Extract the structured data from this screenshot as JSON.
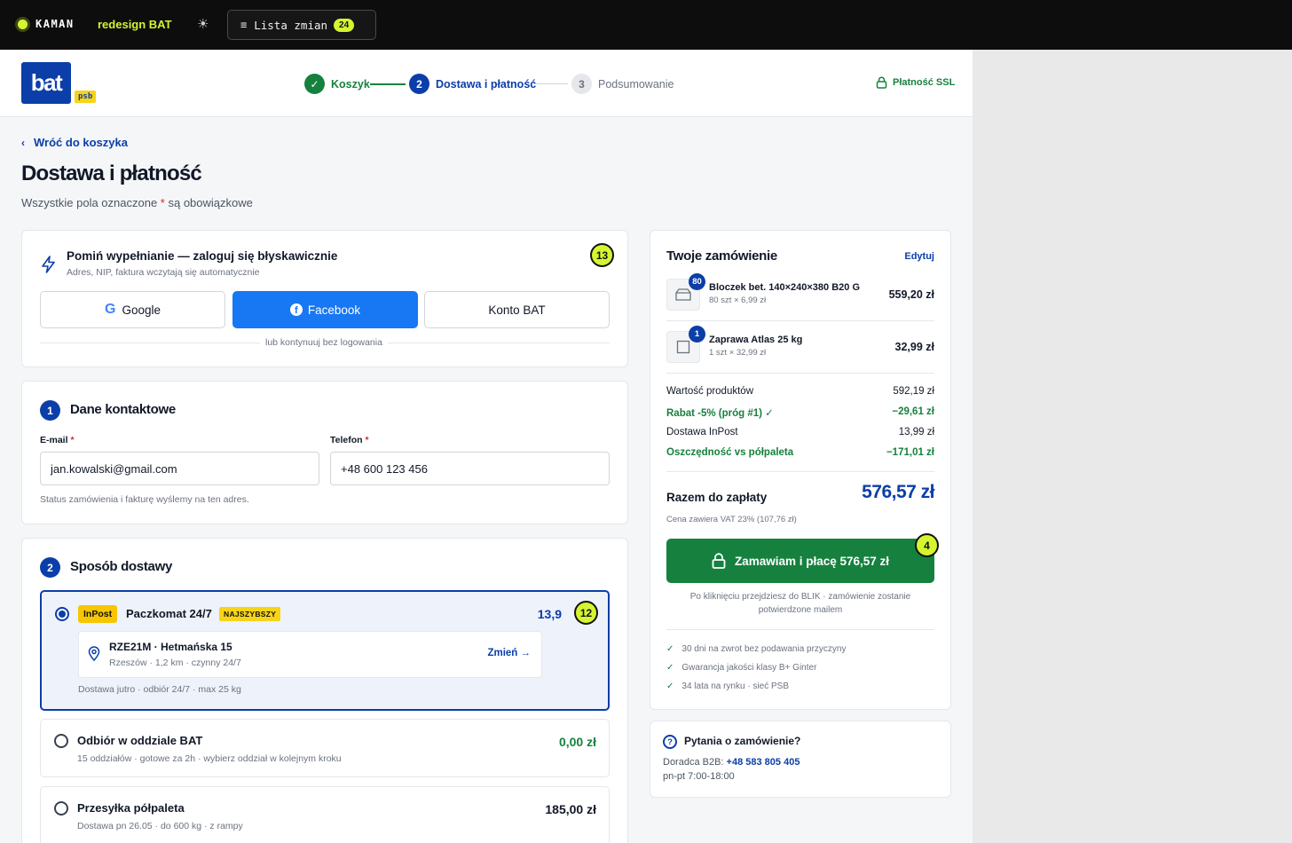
{
  "topbar": {
    "brand": "KAMAN",
    "project": "redesign BAT",
    "theme_icon": "sun-icon",
    "changes_label": "Lista zmian",
    "changes_count": "24"
  },
  "header": {
    "logo_text": "bat",
    "logo_sub": "psb",
    "steps": [
      {
        "num": "✓",
        "label": "Koszyk"
      },
      {
        "num": "2",
        "label": "Dostawa i płatność"
      },
      {
        "num": "3",
        "label": "Podsumowanie"
      }
    ],
    "ssl_label": "Płatność SSL"
  },
  "page": {
    "back_label": "Wróć do koszyka",
    "title": "Dostawa i płatność",
    "subtitle_before": "Wszystkie pola oznaczone ",
    "subtitle_star": "*",
    "subtitle_after": " są obowiązkowe"
  },
  "quick_login": {
    "title": "Pomiń wypełnianie — zaloguj się błyskawicznie",
    "subtitle": "Adres, NIP, faktura wczytają się automatycznie",
    "google_label": "Google",
    "facebook_label": "Facebook",
    "bat_label": "Konto BAT",
    "or_text": "lub kontynuuj bez logowania",
    "marker": "13"
  },
  "contact": {
    "num": "1",
    "title": "Dane kontaktowe",
    "email_label": "E-mail",
    "email_value": "jan.kowalski@gmail.com",
    "phone_label": "Telefon",
    "phone_value": "+48 600 123 456",
    "required_star": "*",
    "hint": "Status zamówienia i fakturę wyślemy na ten adres."
  },
  "delivery": {
    "num": "2",
    "title": "Sposób dostawy",
    "options": [
      {
        "badge": "InPost",
        "name": "Paczkomat 24/7",
        "tag": "NAJSZYBSZY",
        "price": "13,9",
        "locker_name": "RZE21M · Hetmańska 15",
        "locker_details": "Rzeszów · 1,2 km · czynny 24/7",
        "locker_change": "Zmień →",
        "sub": "Dostawa jutro · odbiór 24/7 · max 25 kg",
        "marker": "12"
      },
      {
        "name": "Odbiór w oddziale BAT",
        "price": "0,00 zł",
        "sub": "15 oddziałów · gotowe za 2h · wybierz oddział w kolejnym kroku"
      },
      {
        "name": "Przesyłka półpaleta",
        "price": "185,00 zł",
        "sub": "Dostawa pn 26.05 · do 600 kg · z rampy"
      }
    ]
  },
  "order": {
    "title": "Twoje zamówienie",
    "edit_label": "Edytuj",
    "items": [
      {
        "qty": "80",
        "name": "Bloczek bet. 140×240×380 B20 G",
        "meta": "80 szt × 6,99 zł",
        "price": "559,20 zł"
      },
      {
        "qty": "1",
        "name": "Zaprawa Atlas 25 kg",
        "meta": "1 szt × 32,99 zł",
        "price": "32,99 zł"
      }
    ],
    "summary": [
      {
        "label": "Wartość produktów",
        "value": "592,19 zł",
        "green": false
      },
      {
        "label": "Rabat -5% (próg #1) ✓",
        "value": "−29,61 zł",
        "green": true
      },
      {
        "label": "Dostawa InPost",
        "value": "13,99 zł",
        "green": false
      },
      {
        "label": "Oszczędność vs półpaleta",
        "value": "−171,01 zł",
        "green": true
      }
    ],
    "total_label": "Razem do zapłaty",
    "total_value": "576,57 zł",
    "vat_note": "Cena zawiera VAT 23% (107,76 zł)",
    "pay_label": "Zamawiam i płacę 576,57 zł",
    "pay_marker": "4",
    "pay_hint": "Po kliknięciu przejdziesz do BLIK · zamówienie zostanie potwierdzone mailem",
    "trust": [
      "30 dni na zwrot bez podawania przyczyny",
      "Gwarancja jakości klasy B+ Ginter",
      "34 lata na rynku · sieć PSB"
    ]
  },
  "help": {
    "icon": "?",
    "title": "Pytania o zamówienie?",
    "advisor_label": "Doradca B2B: ",
    "advisor_phone": "+48 583 805 405",
    "hours": "pn-pt 7:00-18:00"
  },
  "colors": {
    "brand_blue": "#0b3ea8",
    "success_green": "#16813e",
    "accent_lime": "#d4f530",
    "inpost_yellow": "#f7c600",
    "facebook_blue": "#1877f2"
  }
}
